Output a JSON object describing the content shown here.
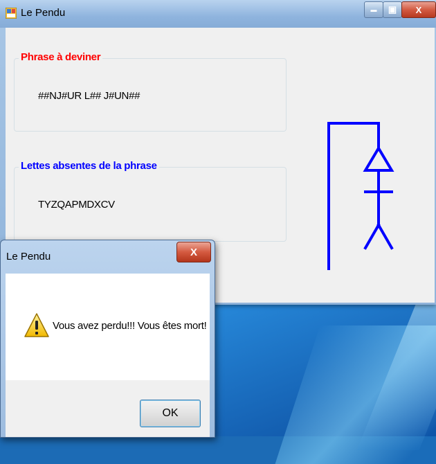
{
  "main_window": {
    "title": "Le Pendu",
    "group_phrase": {
      "legend": "Phrase à deviner",
      "value": "##NJ#UR L## J#UN##"
    },
    "group_absent": {
      "legend": "Lettes absentes de la phrase",
      "value": "TYZQAPMDXCV"
    },
    "controls": {
      "minimize": "▬",
      "maximize": "▣",
      "close": "X"
    }
  },
  "dialog": {
    "title": "Le Pendu",
    "close": "X",
    "message": "Vous avez perdu!!! Vous êtes mort!",
    "ok_label": "OK",
    "icon": "warning-icon"
  },
  "colors": {
    "phrase_legend": "#ff0000",
    "absent_legend": "#0000ff",
    "hangman": "#0000ff"
  }
}
